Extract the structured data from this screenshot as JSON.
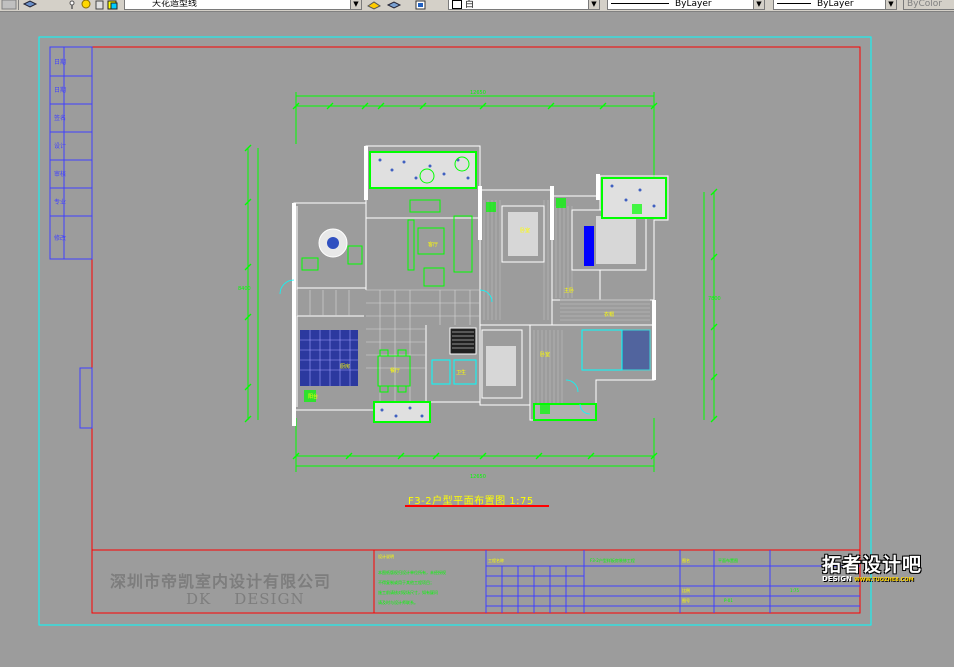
{
  "toolbar": {
    "layer_combo": "天花造型线",
    "color_combo": "白",
    "linetype_combo": "ByLayer",
    "lineweight_combo": "ByLayer",
    "plotstyle_combo": "ByColor"
  },
  "drawing": {
    "plan_title": "F3-2户型平面布置图  1:75",
    "company_name": "深圳市帝凯室内设计有限公司",
    "company_en": "DK    DESIGN",
    "plan_scale": "1:75"
  },
  "watermark": {
    "cn": "拓者设计吧",
    "en": "DESIGN",
    "url": "WWW.TUOZHE8.COM"
  },
  "colors": {
    "background": "#9c9c9c",
    "frame_red": "#ff0000",
    "border_cyan": "#00ffff",
    "walls": "#ffffff",
    "dims_green": "#00ff00",
    "fill_blue": "#0000ff",
    "title_yellow": "#ffff00"
  }
}
